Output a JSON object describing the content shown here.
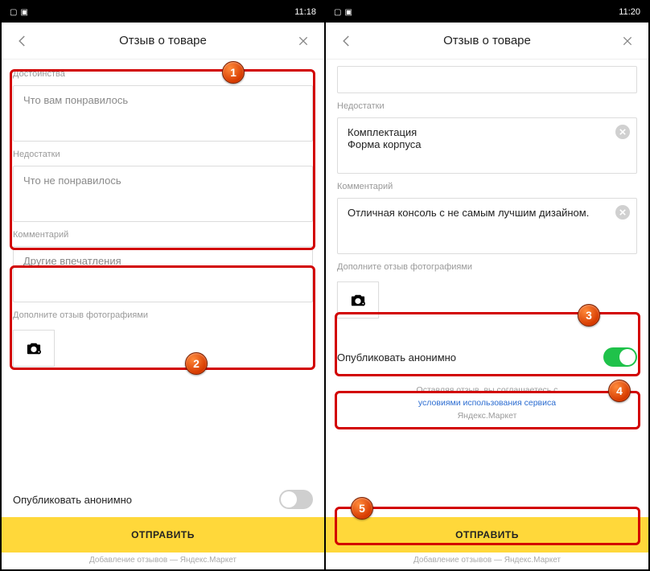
{
  "statusbar": {
    "time_left": "11:18",
    "time_right": "11:20"
  },
  "appbar": {
    "title": "Отзыв о товаре"
  },
  "left": {
    "pros_label": "Достоинства",
    "pros_placeholder": "Что вам понравилось",
    "cons_label": "Недостатки",
    "cons_placeholder": "Что не понравилось",
    "comment_label": "Комментарий",
    "comment_placeholder": "Другие впечатления",
    "photo_label": "Дополните отзыв фотографиями",
    "anon_label": "Опубликовать анонимно",
    "submit": "ОТПРАВИТЬ",
    "caption": "Добавление отзывов — Яндекс.Маркет"
  },
  "right": {
    "cons_label": "Недостатки",
    "cons_value": "Комплектация\nФорма корпуса",
    "comment_label": "Комментарий",
    "comment_value": "Отличная консоль с не самым лучшим дизайном.",
    "photo_label": "Дополните отзыв фотографиями",
    "anon_label": "Опубликовать анонимно",
    "legal_line1": "Оставляя отзыв, вы соглашаетесь с",
    "legal_link": "условиями использования сервиса",
    "legal_line2": "Яндекс.Маркет",
    "submit": "ОТПРАВИТЬ",
    "caption": "Добавление отзывов — Яндекс.Маркет"
  },
  "badges": {
    "b1": "1",
    "b2": "2",
    "b3": "3",
    "b4": "4",
    "b5": "5"
  }
}
